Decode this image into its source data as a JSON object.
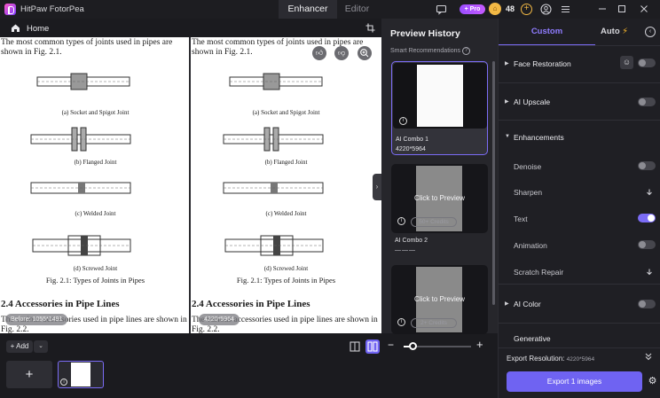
{
  "titlebar": {
    "app_name": "HitPaw FotorPea",
    "tabs": [
      {
        "label": "Enhancer",
        "active": true
      },
      {
        "label": "Editor",
        "active": false
      }
    ],
    "pro_label": "+ Pro",
    "credits": "48"
  },
  "nav": {
    "home_label": "Home"
  },
  "document": {
    "intro": "The most common types of joints used in pipes are shown in Fig. 2.1.",
    "joint_captions": [
      "(a) Socket and Spigot Joint",
      "(b) Flanged Joint",
      "(c) Welded Joint",
      "(d) Screwed Joint"
    ],
    "figure_caption": "Fig. 2.1: Types of Joints in Pipes",
    "section_heading": "2.4   Accessories in Pipe Lines",
    "section_text": "The various accessories used in pipe lines are shown in Fig. 2.2."
  },
  "compare": {
    "before_label": "Before: 1055*1491",
    "after_label": "4220*5964"
  },
  "bottom": {
    "add_label": "Add"
  },
  "history": {
    "title": "Preview History",
    "smart_recommendations": "Smart Recommendations",
    "cards": [
      {
        "name": "AI Combo 1",
        "resolution": "4220*5964"
      },
      {
        "name": "AI Combo 2",
        "overlay": "Click to Preview",
        "cost": "50+ Credits",
        "placeholder": "———"
      },
      {
        "overlay": "Click to Preview",
        "cost": "2+ Credits"
      }
    ]
  },
  "panel": {
    "tab_custom": "Custom",
    "tab_auto": "Auto",
    "sections": {
      "face_restoration": {
        "label": "Face Restoration",
        "enabled": false
      },
      "ai_upscale": {
        "label": "AI Upscale",
        "enabled": false
      },
      "enhancements": {
        "label": "Enhancements",
        "items": [
          {
            "label": "Denoise",
            "enabled": false
          },
          {
            "label": "Sharpen"
          },
          {
            "label": "Text",
            "enabled": true
          },
          {
            "label": "Animation",
            "enabled": false
          },
          {
            "label": "Scratch Repair"
          }
        ]
      },
      "ai_color": {
        "label": "AI Color",
        "enabled": false
      },
      "generative": {
        "label": "Generative"
      }
    },
    "export_resolution_label": "Export Resolution:",
    "export_resolution_value": "4220*5964",
    "export_button": "Export 1 images"
  },
  "colors": {
    "accent": "#7b6cf6",
    "credit_gold": "#f3b945"
  }
}
